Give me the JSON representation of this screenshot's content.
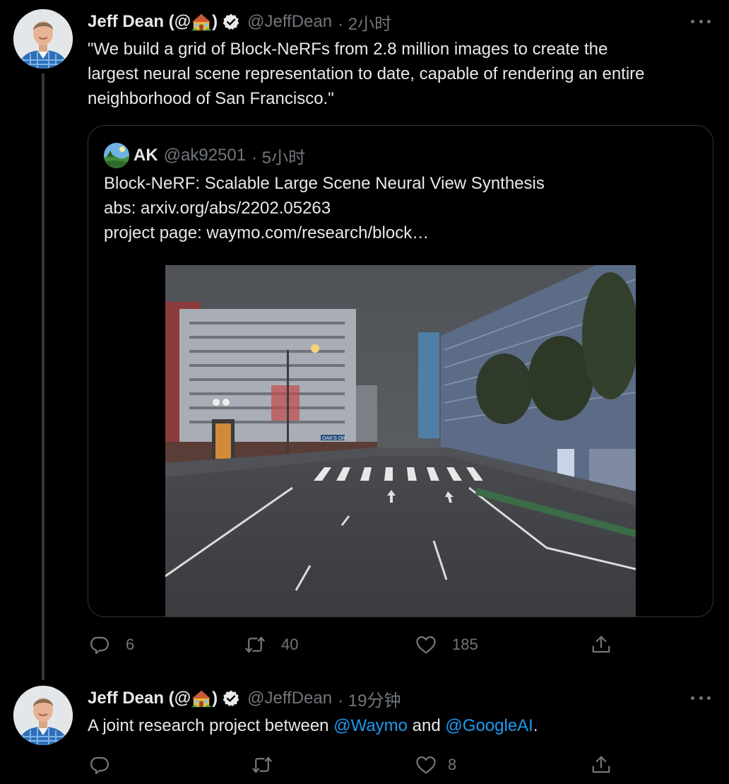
{
  "tweet1": {
    "author_name": "Jeff Dean (@",
    "author_name_end": ")",
    "handle": "@JeffDean",
    "time": "· 2小时",
    "text_lines": [
      "\"We build a grid of Block-NeRFs from 2.8 million images to create the",
      "largest neural scene representation to date, capable of rendering an entire",
      "neighborhood of San Francisco.\""
    ],
    "stats": {
      "replies": "6",
      "retweets": "40",
      "likes": "185"
    }
  },
  "quote": {
    "author_name": "AK",
    "handle": "@ak92501",
    "time": "· 5小时",
    "lines": [
      "Block-NeRF: Scalable Large Scene Neural View Synthesis",
      "abs: arxiv.org/abs/2202.05263",
      "project page: waymo.com/research/block…"
    ],
    "media_alt": "Street scene rendering of San Francisco neighborhood",
    "sign_text": "OAK'S OR"
  },
  "tweet2": {
    "author_name": "Jeff Dean (@",
    "author_name_end": ")",
    "handle": "@JeffDean",
    "time": "· 19分钟",
    "text_before": "A joint research project between ",
    "mention1": "@Waymo",
    "text_mid": " and ",
    "mention2": "@GoogleAI",
    "text_after": ".",
    "stats": {
      "likes": "8"
    }
  },
  "icons": [
    "avatar",
    "house-emoji-icon",
    "verified-icon",
    "more-icon",
    "reply-icon",
    "retweet-icon",
    "like-icon",
    "share-icon"
  ],
  "colors": {
    "background": "#000000",
    "text": "#e7e9ea",
    "secondary": "#71767b",
    "link": "#1d9bf0",
    "border": "#2f3336"
  }
}
